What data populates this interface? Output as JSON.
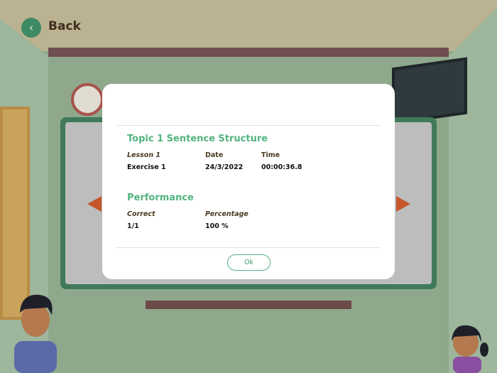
{
  "nav": {
    "back_label": "Back",
    "back_icon": "chevron-left-icon"
  },
  "dialog": {
    "title": "Topic 1 Sentence Structure",
    "lesson_header": "Lesson 1",
    "date_header": "Date",
    "time_header": "Time",
    "lesson_value": "Exercise 1",
    "date_value": "24/3/2022",
    "time_value": "00:00:36.8",
    "performance_title": "Performance",
    "correct_header": "Correct",
    "percentage_header": "Percentage",
    "correct_value": "1/1",
    "percentage_value": "100 %",
    "ok_label": "Ok"
  },
  "colors": {
    "accent": "#52b37f",
    "back_button": "#3d8a64",
    "arrow": "#c4562a"
  }
}
